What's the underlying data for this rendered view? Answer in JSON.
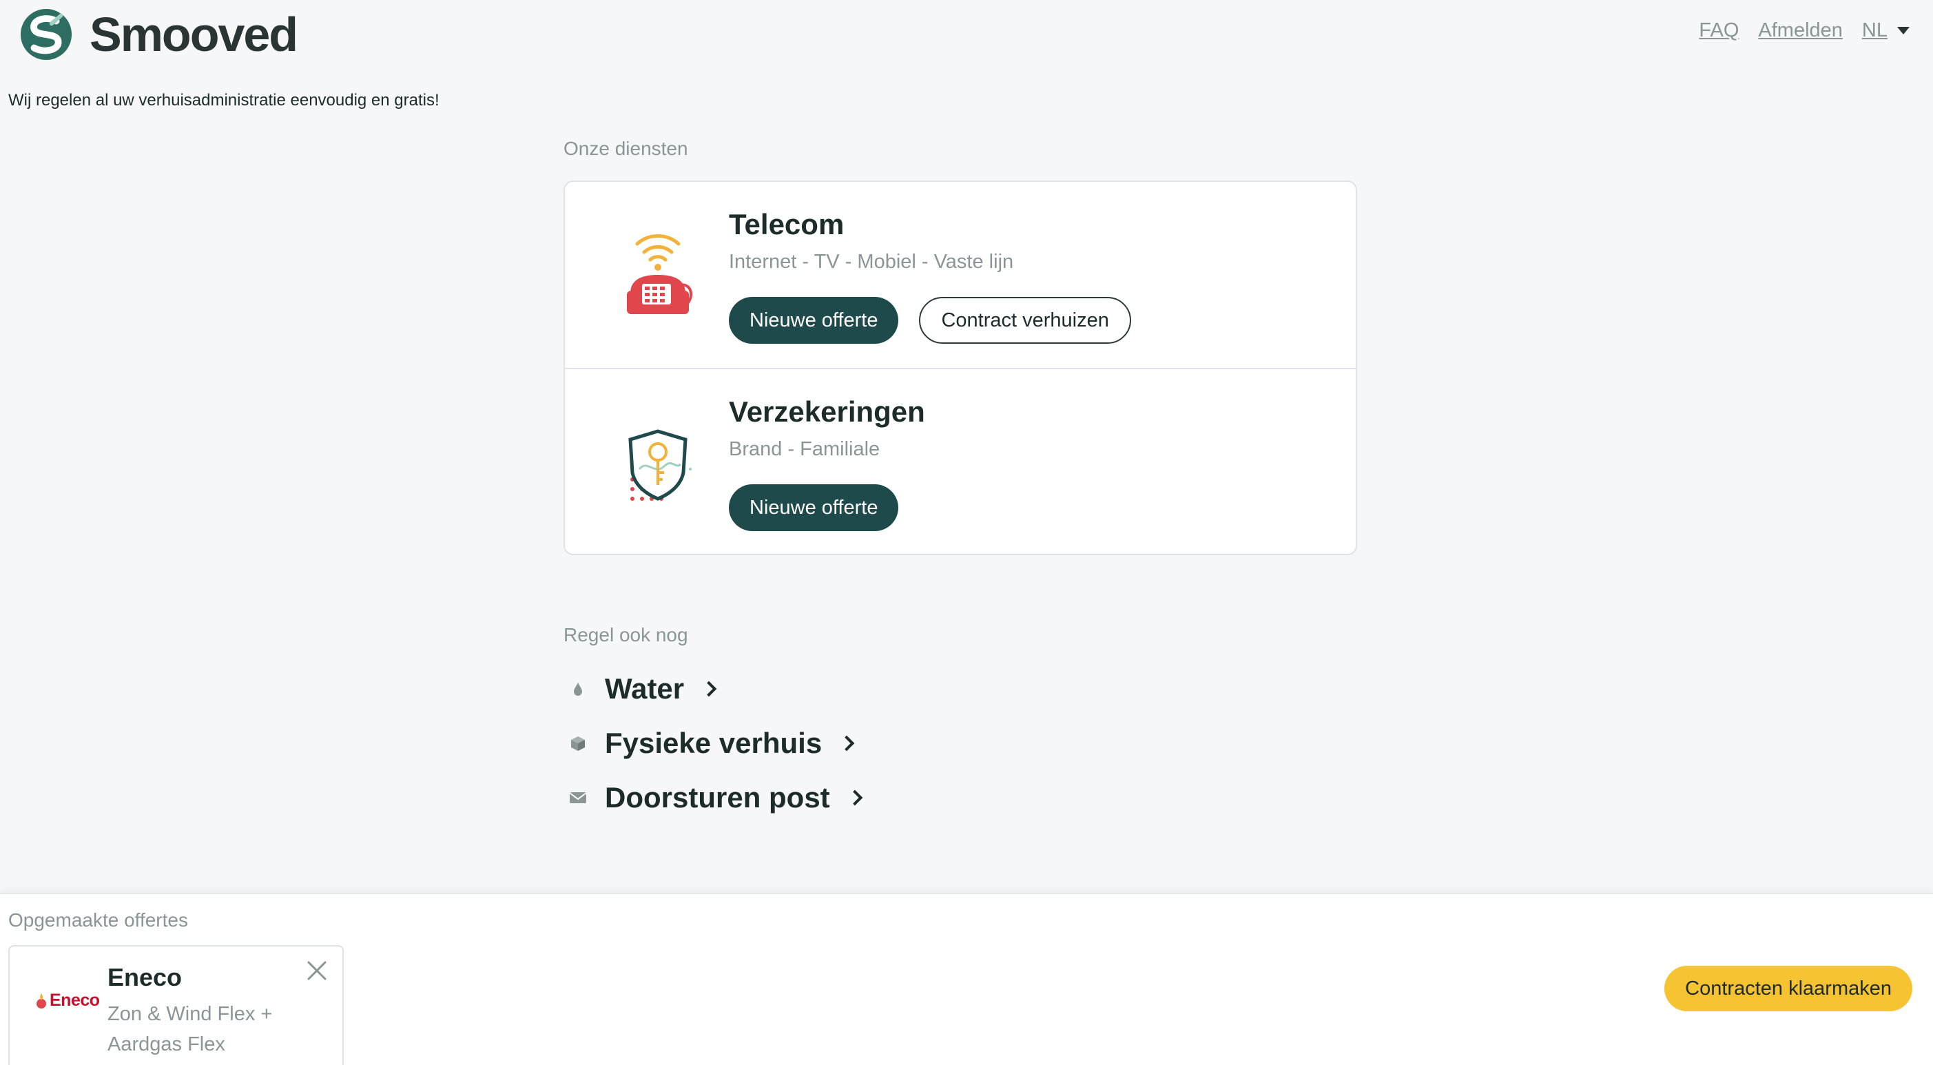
{
  "header": {
    "brand": "Smooved",
    "nav": {
      "faq": "FAQ",
      "logout": "Afmelden",
      "language": "NL"
    }
  },
  "tagline": "Wij regelen al uw verhuisadministratie eenvoudig en gratis!",
  "services": {
    "label": "Onze diensten",
    "items": [
      {
        "icon": "telecom-phone-wifi-icon",
        "title": "Telecom",
        "subtitle": "Internet - TV - Mobiel - Vaste lijn",
        "primary_button": "Nieuwe offerte",
        "secondary_button": "Contract verhuizen"
      },
      {
        "icon": "insurance-shield-key-icon",
        "title": "Verzekeringen",
        "subtitle": "Brand - Familiale",
        "primary_button": "Nieuwe offerte"
      }
    ]
  },
  "more": {
    "label": "Regel ook nog",
    "items": [
      {
        "icon": "water-drop-icon",
        "label": "Water"
      },
      {
        "icon": "box-icon",
        "label": "Fysieke verhuis"
      },
      {
        "icon": "envelope-icon",
        "label": "Doorsturen post"
      }
    ]
  },
  "bottom": {
    "label": "Opgemaakte offertes",
    "offer": {
      "logo_text": "Eneco",
      "title": "Eneco",
      "description": "Zon & Wind Flex + Aardgas Flex"
    },
    "cta": "Contracten klaarmaken"
  },
  "colors": {
    "primary": "#1f4a4b",
    "accent_yellow": "#f6c333",
    "background": "#f6f7f9",
    "muted_text": "#8a9596"
  }
}
